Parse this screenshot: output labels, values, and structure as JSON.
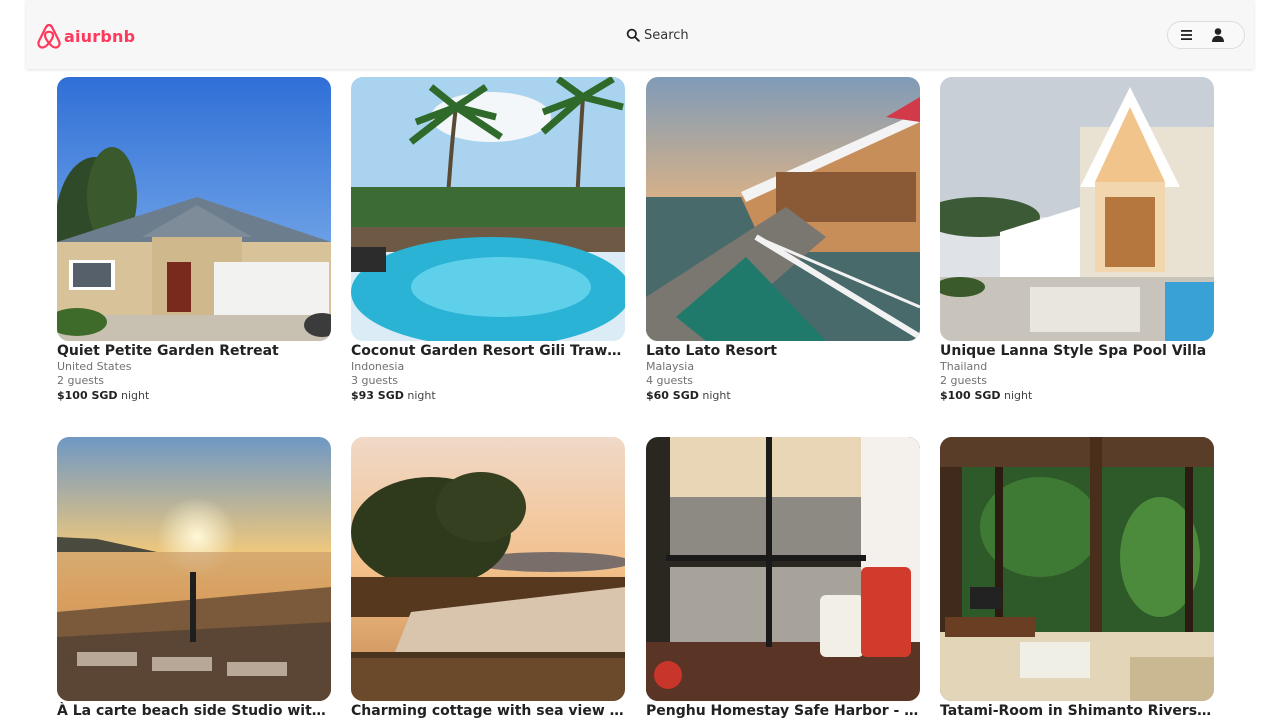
{
  "brand": {
    "name": "aiurbnb",
    "color": "#ff385c"
  },
  "header": {
    "search_label": "Search",
    "search_icon": "search-icon",
    "menu_icon": "hamburger-icon",
    "profile_icon": "user-icon"
  },
  "listings": [
    {
      "title": "Quiet Petite Garden Retreat",
      "location": "United States",
      "guests": "2 guests",
      "price": "$100 SGD",
      "unit": "night",
      "photo": "suburban-house"
    },
    {
      "title": "Coconut Garden Resort Gili Trawan…",
      "location": "Indonesia",
      "guests": "3 guests",
      "price": "$93 SGD",
      "unit": "night",
      "photo": "palm-pool"
    },
    {
      "title": "Lato Lato Resort",
      "location": "Malaysia",
      "guests": "4 guests",
      "price": "$60 SGD",
      "unit": "night",
      "photo": "stilt-resort"
    },
    {
      "title": "Unique Lanna Style Spa Pool Villa",
      "location": "Thailand",
      "guests": "2 guests",
      "price": "$100 SGD",
      "unit": "night",
      "photo": "thai-villa"
    },
    {
      "title": "À La carte beach side Studio with p…",
      "photo": "sunset-yoga"
    },
    {
      "title": "Charming cottage with sea view in …",
      "photo": "infinity-pool-sunset"
    },
    {
      "title": "Penghu Homestay Safe Harbor - 72…",
      "photo": "window-seat"
    },
    {
      "title": "Tatami-Room in Shimanto Riverside…",
      "photo": "tatami-room"
    }
  ]
}
